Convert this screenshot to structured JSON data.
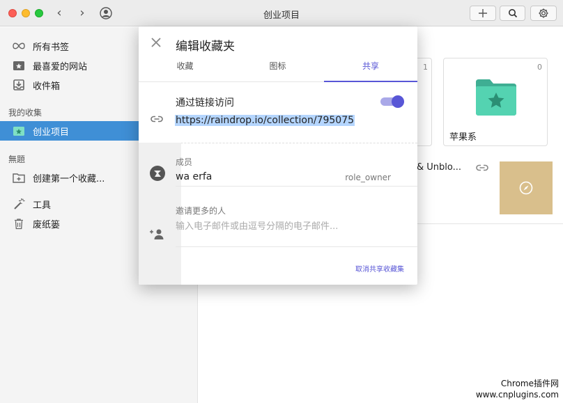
{
  "window": {
    "title": "创业项目"
  },
  "sidebar": {
    "items": [
      {
        "label": "所有书签",
        "icon": "infinity-icon"
      },
      {
        "label": "最喜爱的网站",
        "icon": "star-folder-icon"
      },
      {
        "label": "收件箱",
        "icon": "inbox-icon"
      }
    ],
    "section_my": "我的收集",
    "collections": [
      {
        "label": "创业项目",
        "icon": "star-folder-icon",
        "active": true
      }
    ],
    "section_untitled": "無題",
    "create": {
      "label": "创建第一个收藏...",
      "icon": "add-folder-icon"
    },
    "tools": {
      "label": "工具",
      "icon": "magic-wand-icon"
    },
    "trash": {
      "label": "废纸篓",
      "icon": "trash-icon"
    }
  },
  "main": {
    "partial_card_count": "1",
    "card": {
      "name": "苹果系",
      "count": "0"
    },
    "row": {
      "title": "& Unblo..."
    }
  },
  "dialog": {
    "title": "编辑收藏夹",
    "tabs": [
      "收藏",
      "图标",
      "共享"
    ],
    "active_tab": "共享",
    "share_label": "通过链接访问",
    "share_enabled": true,
    "share_url": "https://raindrop.io/collection/795075",
    "members_label": "成员",
    "member": {
      "name": "wa erfa",
      "role": "role_owner"
    },
    "invite_label": "邀请更多的人",
    "invite_placeholder": "输入电子邮件或由逗号分隔的电子邮件...",
    "unshare_label": "取消共享收藏集"
  },
  "watermark": {
    "line1": "Chrome插件网",
    "line2": "www.cnplugins.com"
  },
  "colors": {
    "accent": "#5856d6",
    "sidebar_active": "#3f8fd6",
    "folder": "#4fcfb0",
    "thumb": "#d9bf8c"
  }
}
